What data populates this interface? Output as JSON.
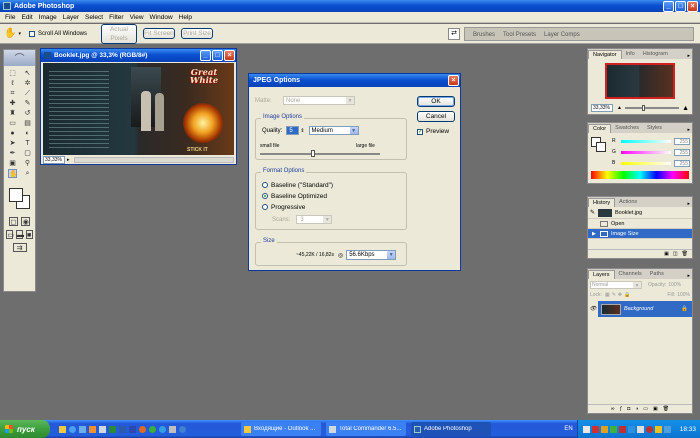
{
  "app": {
    "title": "Adobe Photoshop",
    "menu": [
      "File",
      "Edit",
      "Image",
      "Layer",
      "Select",
      "Filter",
      "View",
      "Window",
      "Help"
    ]
  },
  "options_bar": {
    "scroll_all_windows": "Scroll All Windows",
    "actual_pixels": "Actual Pixels",
    "fit_screen": "Fit Screen",
    "print_size": "Print Size",
    "well_tabs": [
      "Brushes",
      "Tool Presets",
      "Layer Comps"
    ]
  },
  "document": {
    "title": "Booklet.jpg @ 33,3% (RGB/8#)",
    "zoom": "33,33%",
    "artwork": {
      "logo": "Great White",
      "tagline": "STICK IT"
    }
  },
  "jpeg_dialog": {
    "title": "JPEG Options",
    "matte_label": "Matte:",
    "matte_value": "None",
    "image_options_title": "Image Options",
    "quality_label": "Quality:",
    "quality_value": "5",
    "quality_preset": "Medium",
    "small_file": "small file",
    "large_file": "large file",
    "quality_fraction": 0.42,
    "format_options_title": "Format Options",
    "formats": [
      "Baseline (\"Standard\")",
      "Baseline Optimized",
      "Progressive"
    ],
    "selected_format": 1,
    "scans_label": "Scans:",
    "scans_value": "3",
    "size_title": "Size",
    "size_estimate": "~45,22K / 16,82s",
    "size_speed": "56.6Kbps",
    "ok": "OK",
    "cancel": "Cancel",
    "preview": "Preview",
    "preview_checked": true
  },
  "navigator": {
    "tabs": [
      "Navigator",
      "Info",
      "Histogram"
    ],
    "zoom": "33,33%"
  },
  "color": {
    "tabs": [
      "Color",
      "Swatches",
      "Styles"
    ],
    "channels": [
      {
        "label": "R",
        "value": "255",
        "color": "#e02020"
      },
      {
        "label": "G",
        "value": "255",
        "color": "#c020c0"
      },
      {
        "label": "B",
        "value": "255",
        "color": "#2020e0"
      }
    ]
  },
  "history": {
    "tabs": [
      "History",
      "Actions"
    ],
    "snapshot": "Booklet.jpg",
    "items": [
      "Open",
      "Image Size"
    ],
    "active_index": 1
  },
  "layers": {
    "tabs": [
      "Layers",
      "Channels",
      "Paths"
    ],
    "blend_mode": "Normal",
    "opacity_label": "Opacity:",
    "opacity": "100%",
    "lock_label": "Lock:",
    "fill_label": "Fill:",
    "fill": "100%",
    "layer_name": "Background"
  },
  "taskbar": {
    "start": "пуск",
    "tasks": [
      "Входящие - Outlook ...",
      "Total Commander 6.5...",
      "Adobe Photoshop"
    ],
    "language": "EN",
    "clock": "18:33"
  },
  "colors": {
    "xp_blue": "#0a4fd0",
    "selection": "#316ac5",
    "dialog_bg": "#ece9d8",
    "workspace": "#6e6e6e",
    "start_green": "#3c9f3c"
  }
}
